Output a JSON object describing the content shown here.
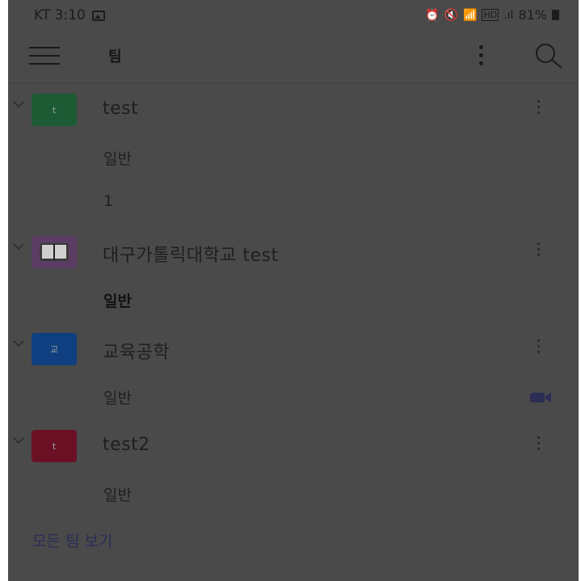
{
  "status_bar": {
    "carrier_time": "KT 3:10",
    "battery_percent": "81%"
  },
  "header": {
    "title": "팀"
  },
  "teams": [
    {
      "name": "test",
      "avatar_text": "t",
      "avatar_color": "#1d5b35",
      "channels": [
        {
          "name": "일반",
          "bold": false
        },
        {
          "name": "1",
          "bold": false
        }
      ]
    },
    {
      "name": "대구가톨릭대학교 test",
      "avatar_text": "",
      "avatar_color": "#5b3d63",
      "avatar_icon": "book-icon",
      "channels": [
        {
          "name": "일반",
          "bold": true
        }
      ]
    },
    {
      "name": "교육공학",
      "avatar_text": "교",
      "avatar_color": "#0f3f80",
      "channels": [
        {
          "name": "일반",
          "bold": false,
          "meeting_icon": "video-camera-icon"
        }
      ]
    },
    {
      "name": "test2",
      "avatar_text": "t",
      "avatar_color": "#6a1025",
      "channels": [
        {
          "name": "일반",
          "bold": false
        }
      ]
    }
  ],
  "footer": {
    "see_all_label": "모든 팀 보기"
  },
  "colors": {
    "dim_overlay": "#4a4a4a",
    "link": "#2b2d55"
  }
}
